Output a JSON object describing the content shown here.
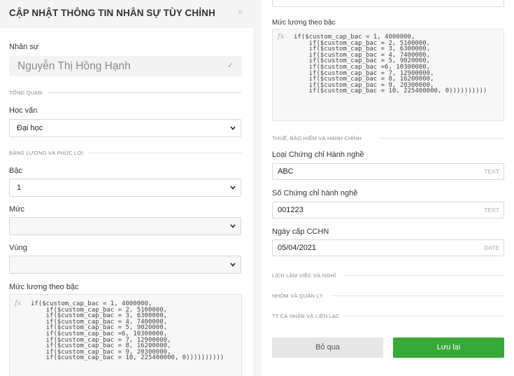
{
  "modal": {
    "title": "CẬP NHẬT THÔNG TIN NHÂN SỰ TÙY CHỈNH",
    "close_icon": "×"
  },
  "employee": {
    "label": "Nhân sự",
    "name": "Nguyễn Thị Hồng Hạnh",
    "check_icon": "✓"
  },
  "sections": {
    "overview": "TỔNG QUAN",
    "salary": "BẢNG LƯƠNG VÀ PHÚC LỢI",
    "tax": "THUẾ, BẢO HIỂM VÀ HÀNH CHÍNH",
    "schedule": "LỊCH LÀM VIỆC VÀ NGHỈ",
    "group": "NHÓM VÀ QUẢN LÝ",
    "personal": "TT CÁ NHÂN VÀ LIÊN LẠC"
  },
  "education": {
    "label": "Học vấn",
    "value": "Đại học"
  },
  "grade": {
    "label": "Bậc",
    "value": "1"
  },
  "level": {
    "label": "Mức",
    "value": ""
  },
  "region": {
    "label": "Vùng",
    "value": ""
  },
  "salary_formula": {
    "label": "Mức lương theo bậc",
    "fx": "fx",
    "code": "if($custom_cap_bac = 1, 4000000,\n    if($custom_cap_bac = 2, 5100000,\n    if($custom_cap_bac = 3, 6300000,\n    if($custom_cap_bac = 4, 7400000,\n    if($custom_cap_bac = 5, 9020000,\n    if($custom_cap_bac =6, 10300000,\n    if($custom_cap_bac = 7, 12900000,\n    if($custom_cap_bac = 8, 16200000,\n    if($custom_cap_bac = 9, 20300000,\n    if($custom_cap_bac = 10, 225400000, 0))))))))))"
  },
  "license_type": {
    "label": "Loại Chứng chỉ Hành nghề",
    "value": "ABC",
    "type": "TEXT"
  },
  "license_number": {
    "label": "Số Chứng chỉ hành nghề",
    "value": "001223",
    "type": "TEXT"
  },
  "license_date": {
    "label": "Ngày cấp CCHN",
    "value": "05/04/2021",
    "type": "DATE"
  },
  "buttons": {
    "cancel": "Bỏ qua",
    "save": "Lưu lại"
  },
  "colors": {
    "accent": "#36a936",
    "header_bg": "#f5f5f5"
  }
}
